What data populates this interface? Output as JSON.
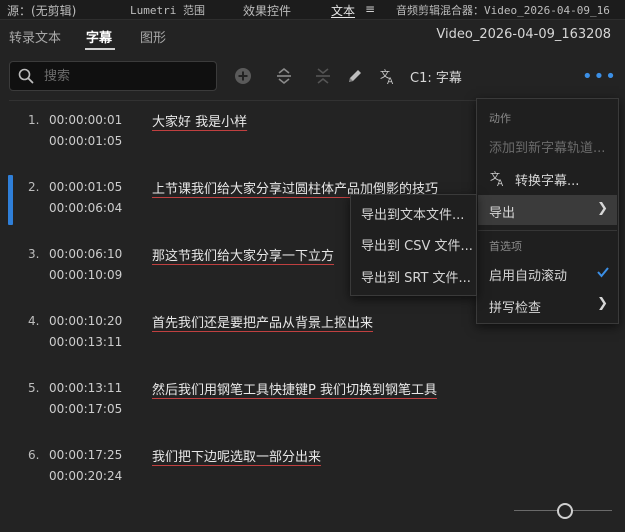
{
  "panel_tabs": [
    "源：(无剪辑)",
    "Lumetri 范围",
    "效果控件",
    "文本",
    "音频剪辑混合器：Video_2026-04-09_16"
  ],
  "sub_tabs": [
    "转录文本",
    "字幕",
    "图形"
  ],
  "sequence_name": "Video_2026-04-09_163208",
  "search": {
    "placeholder": "搜索",
    "value": ""
  },
  "toolbar": {
    "caption_track": "C1: 字幕"
  },
  "captions": [
    {
      "num": "1.",
      "start": "00:00:00:01",
      "end": "00:00:01:05",
      "text": "大家好 我是小样"
    },
    {
      "num": "2.",
      "start": "00:00:01:05",
      "end": "00:00:06:04",
      "text": "上节课我们给大家分享过圆柱体产品加倒影的技巧"
    },
    {
      "num": "3.",
      "start": "00:00:06:10",
      "end": "00:00:10:09",
      "text": "那这节我们给大家分享一下立方"
    },
    {
      "num": "4.",
      "start": "00:00:10:20",
      "end": "00:00:13:11",
      "text": "首先我们还是要把产品从背景上抠出来"
    },
    {
      "num": "5.",
      "start": "00:00:13:11",
      "end": "00:00:17:05",
      "text": "然后我们用钢笔工具快捷键P 我们切换到钢笔工具"
    },
    {
      "num": "6.",
      "start": "00:00:17:25",
      "end": "00:00:20:24",
      "text": "我们把下边呢选取一部分出来"
    }
  ],
  "context_menu": {
    "section_actions": "动作",
    "add_to_track": "添加到新字幕轨道...",
    "convert": "转换字幕...",
    "export": "导出",
    "section_prefs": "首选项",
    "auto_scroll": "启用自动滚动",
    "spellcheck": "拼写检查"
  },
  "export_submenu": [
    "导出到文本文件...",
    "导出到 CSV 文件...",
    "导出到 SRT 文件..."
  ],
  "colors": {
    "accent": "#3b8fe6",
    "selection_marker": "#2f7fd8",
    "spell_underline": "#c04040"
  },
  "icons": [
    "search-icon",
    "add-icon",
    "split-icon",
    "merge-icon",
    "pencil-icon",
    "translate-icon",
    "more-icon",
    "chevron-right-icon",
    "checkmark-icon"
  ]
}
